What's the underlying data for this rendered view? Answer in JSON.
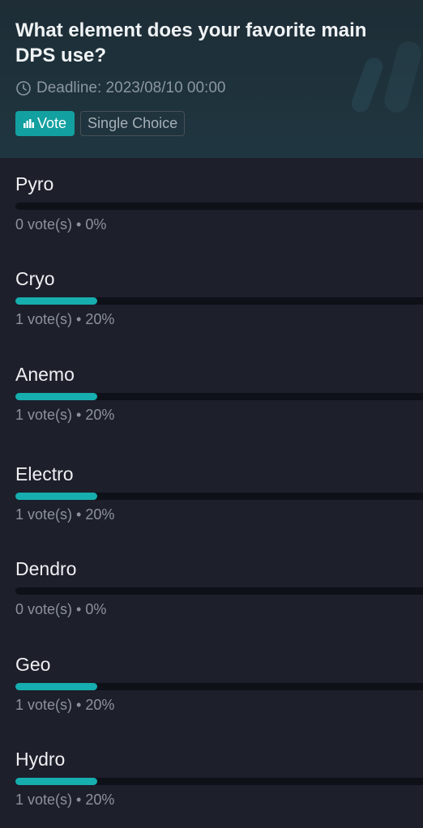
{
  "poll": {
    "title": "What element does your favorite main DPS use?",
    "deadline": "Deadline: 2023/08/10 00:00",
    "vote_tag": "Vote",
    "type_tag": "Single Choice"
  },
  "options": [
    {
      "label": "Pyro",
      "stats": "0 vote(s) • 0%",
      "percent": 0
    },
    {
      "label": "Cryo",
      "stats": "1 vote(s) • 20%",
      "percent": 20
    },
    {
      "label": "Anemo",
      "stats": "1 vote(s) • 20%",
      "percent": 20
    },
    {
      "label": "Electro",
      "stats": "1 vote(s) • 20%",
      "percent": 20
    },
    {
      "label": "Dendro",
      "stats": "0 vote(s) • 0%",
      "percent": 0
    },
    {
      "label": "Geo",
      "stats": "1 vote(s) • 20%",
      "percent": 20
    },
    {
      "label": "Hydro",
      "stats": "1 vote(s) • 20%",
      "percent": 20
    }
  ],
  "colors": {
    "accent": "#16aeae",
    "background": "#1d1f2b",
    "header_bg": "#1f3640"
  },
  "icons": {
    "deadline": "clock-icon",
    "vote": "bar-chart-icon"
  }
}
